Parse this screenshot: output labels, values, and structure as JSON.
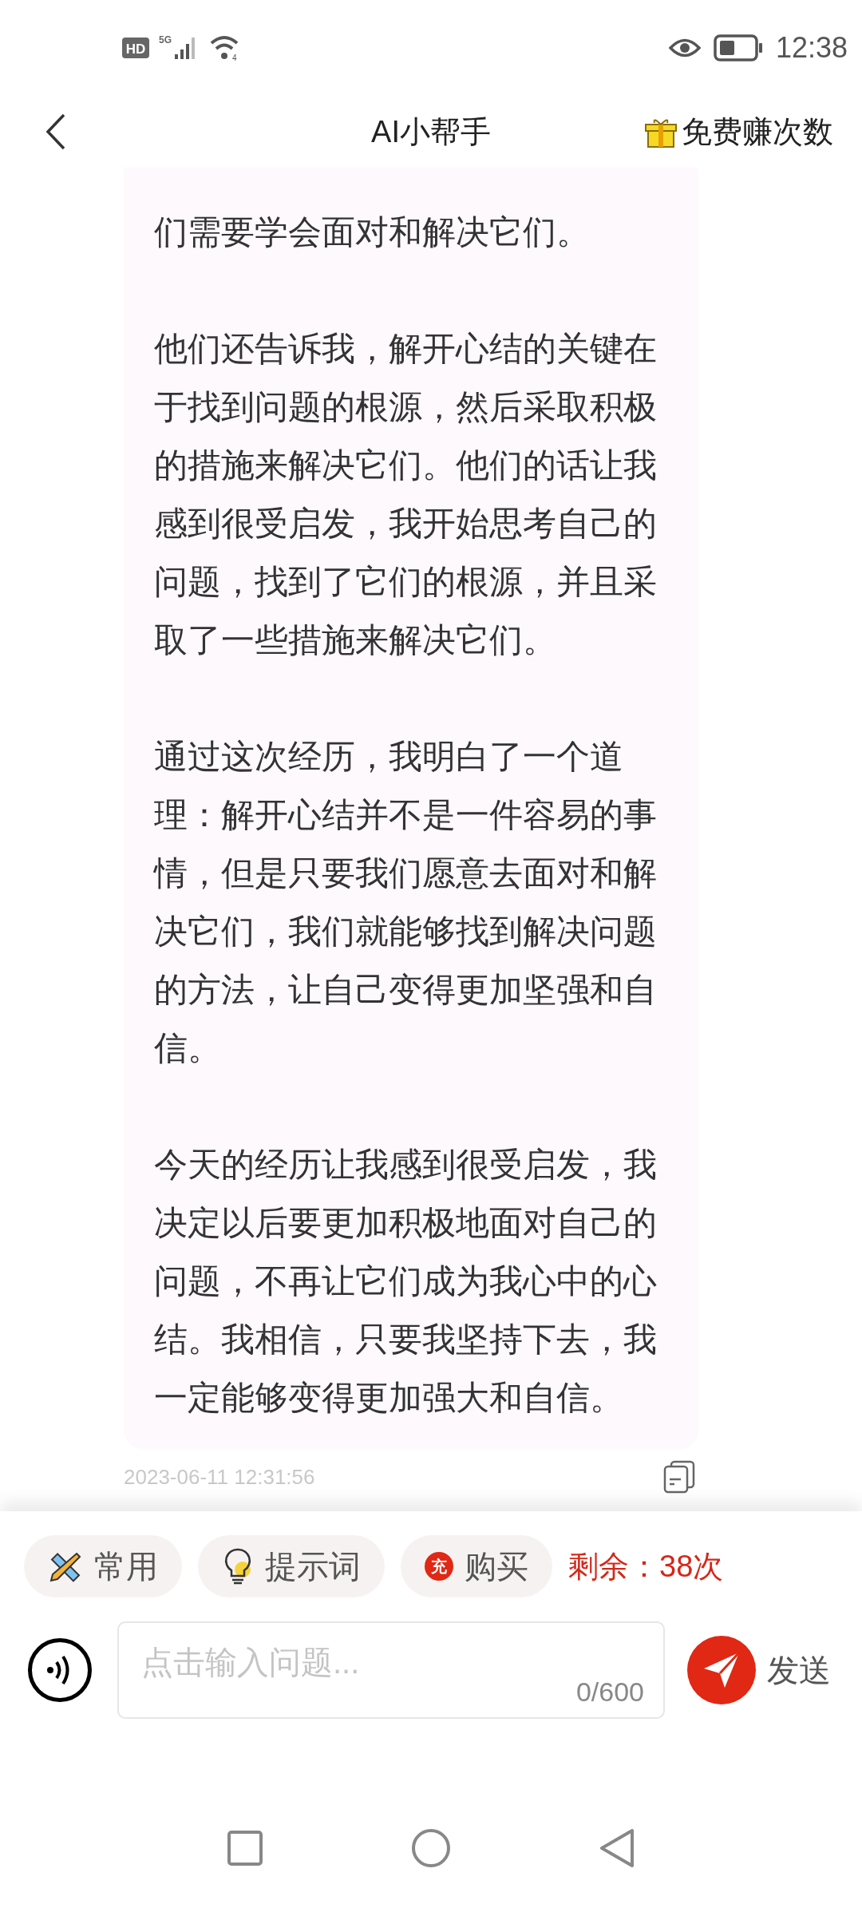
{
  "status_bar": {
    "hd": "HD",
    "network": "5G",
    "wifi_badge": "4",
    "time": "12:38"
  },
  "header": {
    "title": "AI小帮手",
    "action": "免费赚次数"
  },
  "message": {
    "paragraphs": [
      "们需要学会面对和解决它们。",
      "他们还告诉我，解开心结的关键在于找到问题的根源，然后采取积极的措施来解决它们。他们的话让我感到很受启发，我开始思考自己的问题，找到了它们的根源，并且采取了一些措施来解决它们。",
      "通过这次经历，我明白了一个道理：解开心结并不是一件容易的事情，但是只要我们愿意去面对和解决它们，我们就能够找到解决问题的方法，让自己变得更加坚强和自信。",
      "今天的经历让我感到很受启发，我决定以后要更加积极地面对自己的问题，不再让它们成为我心中的心结。我相信，只要我坚持下去，我一定能够变得更加强大和自信。"
    ],
    "timestamp": "2023-06-11 12:31:56"
  },
  "chips": [
    {
      "kind": "tools",
      "label": "常用"
    },
    {
      "kind": "bulb",
      "label": "提示词"
    },
    {
      "kind": "charge",
      "label": "购买",
      "badge": "充"
    }
  ],
  "remaining": "剩余：38次",
  "input": {
    "placeholder": "点击输入问题...",
    "counter": "0/600"
  },
  "send_button": "发送"
}
